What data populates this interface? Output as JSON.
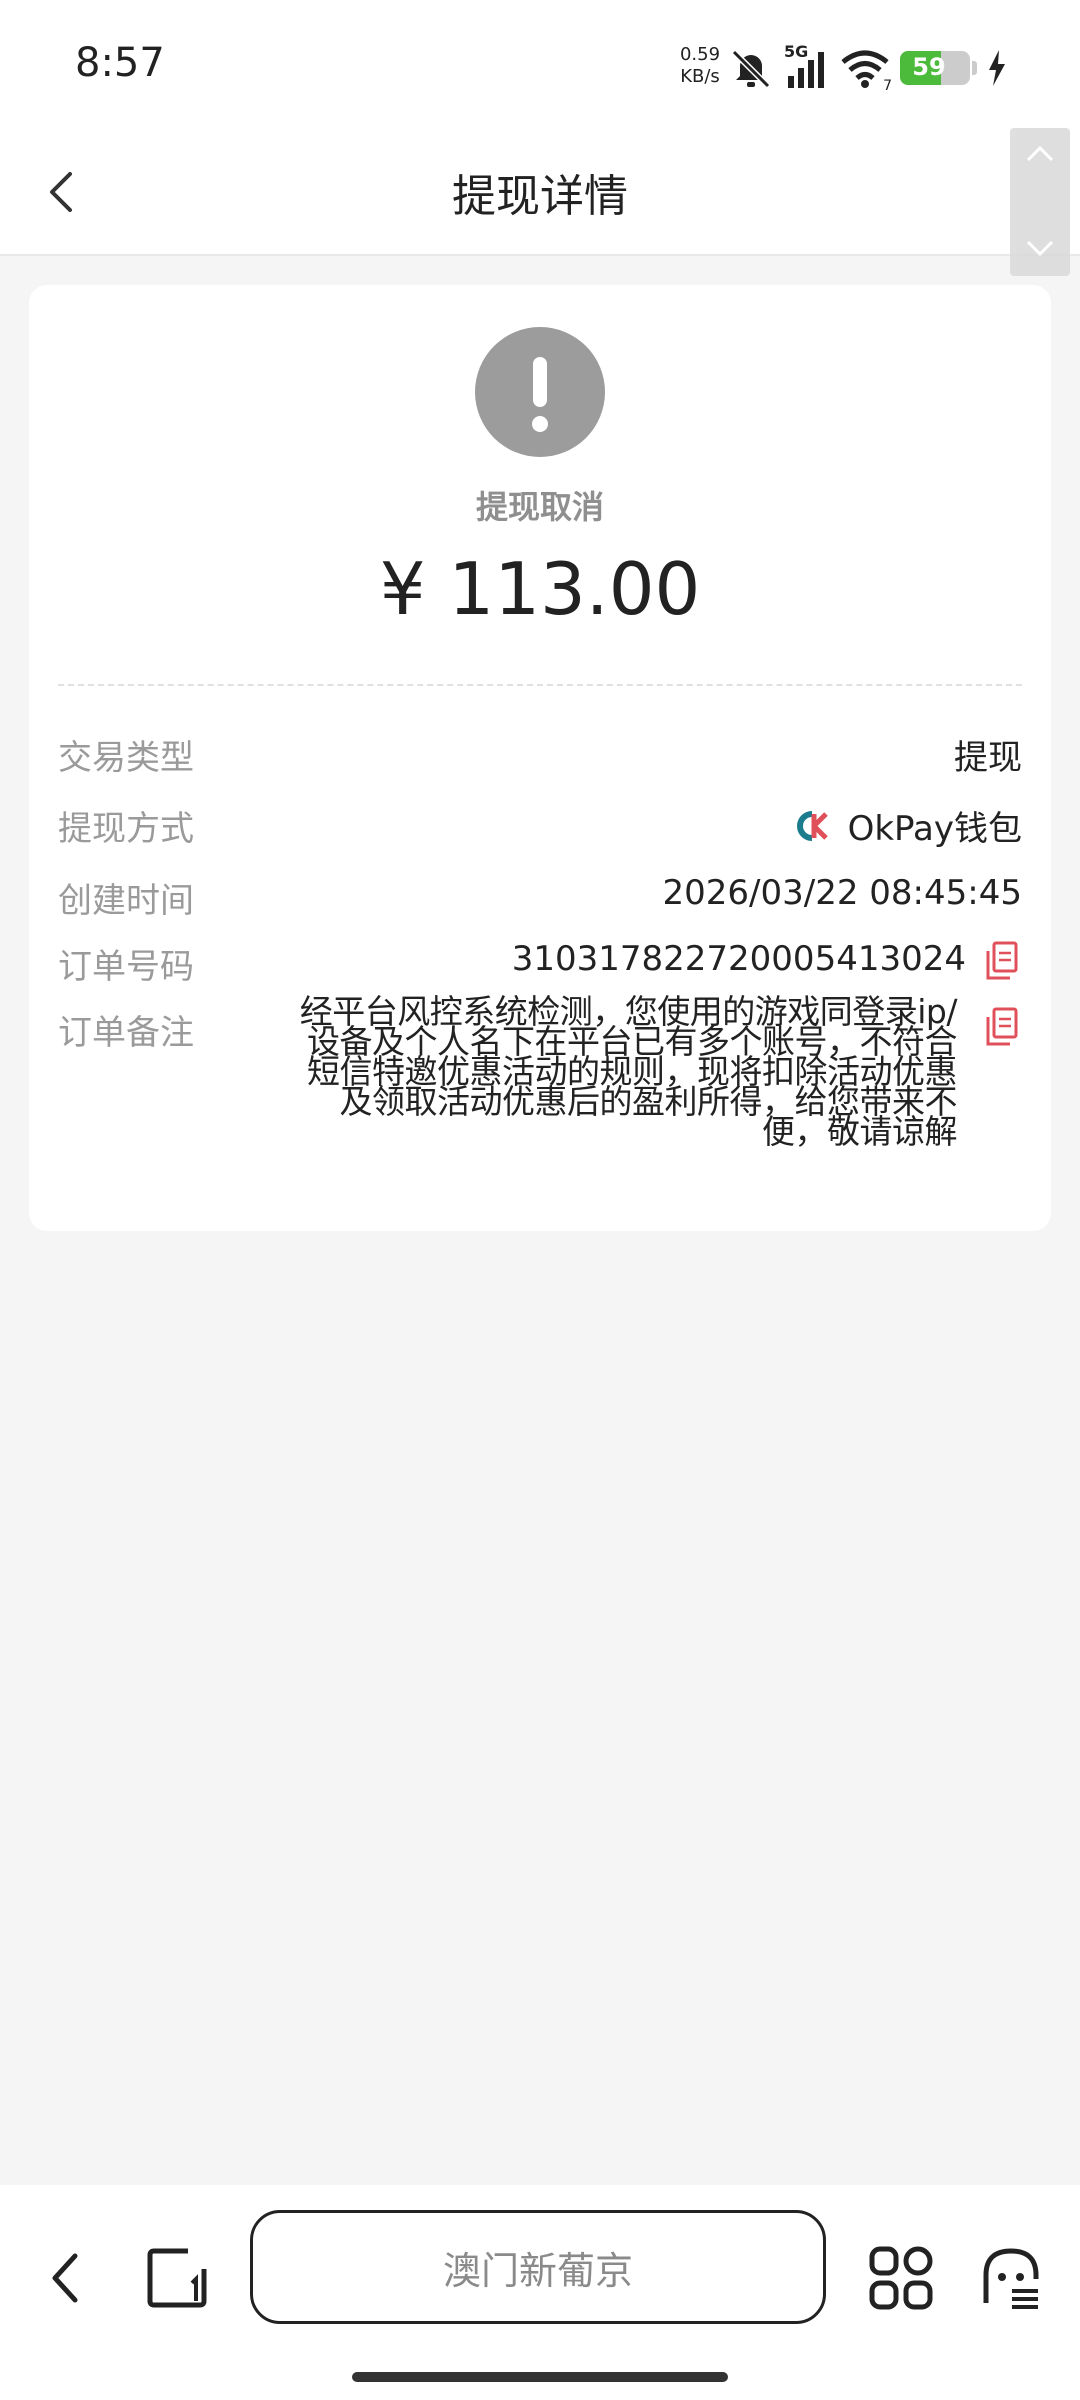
{
  "status_bar": {
    "time": "8:57",
    "net_speed_value": "0.59",
    "net_speed_unit": "KB/s",
    "signal_label": "5G",
    "wifi_label": "7",
    "battery_level": "59",
    "icons": [
      "mute-icon",
      "cellular-signal-icon",
      "wifi-icon",
      "battery-icon",
      "charging-icon"
    ]
  },
  "header": {
    "title": "提现详情",
    "back_icon": "chevron-left-icon"
  },
  "status": {
    "icon": "exclamation-icon",
    "text": "提现取消",
    "amount": "¥ 113.00"
  },
  "details": {
    "transaction_type": {
      "label": "交易类型",
      "value": "提现"
    },
    "withdraw_method": {
      "label": "提现方式",
      "value": "OkPay钱包",
      "logo_text": "OK"
    },
    "created_time": {
      "label": "创建时间",
      "value": "2026/03/22 08:45:45"
    },
    "order_number": {
      "label": "订单号码",
      "value": "310317822720005413024"
    },
    "order_remark": {
      "label": "订单备注",
      "value": "经平台风控系统检测，您使用的游戏同登录ip/设备及个人名下在平台已有多个账号，不符合短信特邀优惠活动的规则，现将扣除活动优惠及领取活动优惠后的盈利所得，给您带来不便，敬请谅解"
    }
  },
  "colors": {
    "accent_red": "#e0505a",
    "status_gray": "#9c9c9c",
    "battery_green": "#4cbb3b"
  },
  "bottom_bar": {
    "url_text": "澳门新葡京",
    "icons": [
      "back-icon",
      "tabs-icon",
      "apps-grid-icon",
      "assistant-icon"
    ]
  }
}
